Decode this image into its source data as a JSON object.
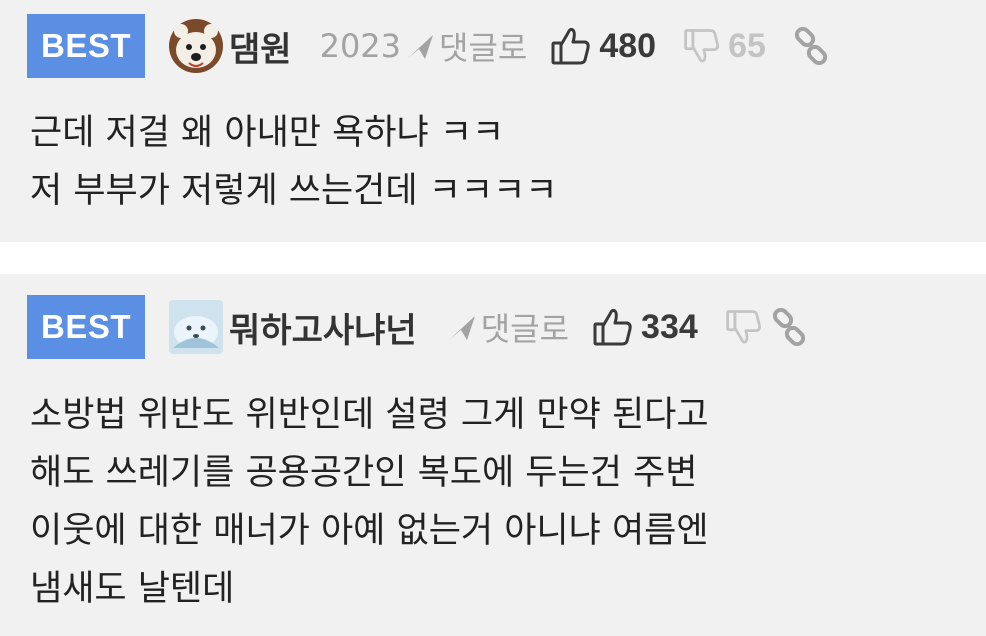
{
  "colors": {
    "best_badge": "#5b8fe3",
    "background": "#f1f1f1",
    "muted_text": "#a3a3a3"
  },
  "comments": [
    {
      "badge": "BEST",
      "avatar_icon": "polar-bear-avatar-icon",
      "nickname": "댐원",
      "year": "2023",
      "reply_label": "댓글로",
      "likes": "480",
      "dislikes": "65",
      "lines": [
        "근데 저걸 왜 아내만 욕하냐 ㅋㅋ",
        "저 부부가 저렇게 쓰는건데 ㅋㅋㅋㅋ"
      ]
    },
    {
      "badge": "BEST",
      "avatar_icon": "snow-animal-avatar-icon",
      "nickname": "뭐하고사냐넌",
      "reply_label": "댓글로",
      "likes": "334",
      "lines": [
        "소방법 위반도 위반인데 설령 그게 만약 된다고",
        "해도 쓰레기를 공용공간인 복도에 두는건 주변",
        "이웃에 대한 매너가 아예 없는거 아니냐 여름엔",
        "냄새도 날텐데"
      ]
    }
  ]
}
